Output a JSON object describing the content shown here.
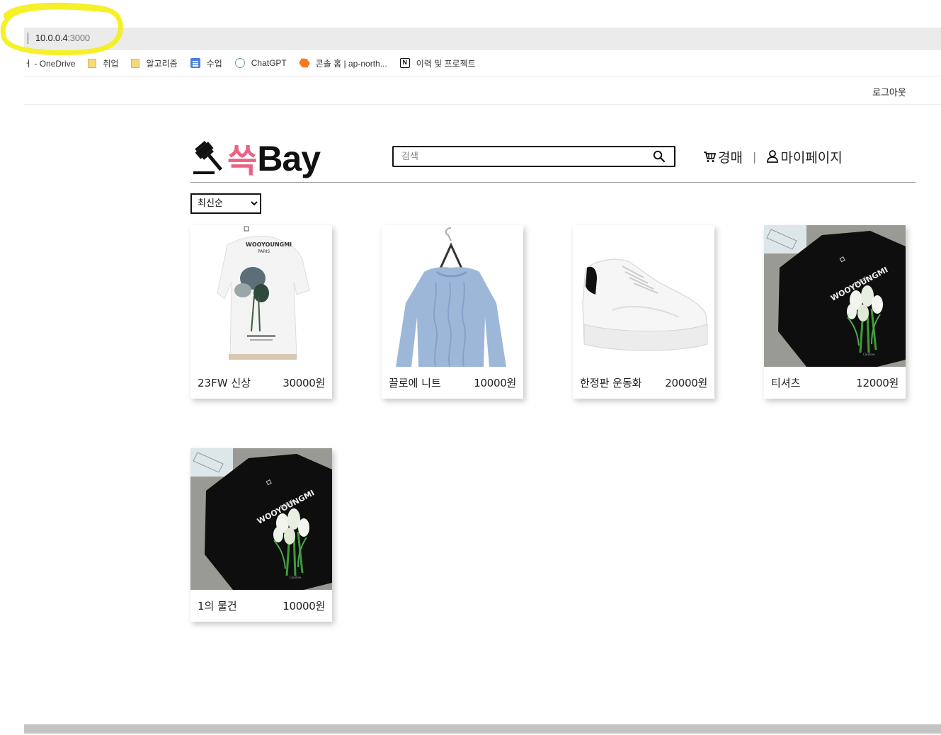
{
  "browser": {
    "url_host": "10.0.0.4",
    "url_port": ":3000",
    "bookmarks": [
      {
        "label": "ㅓ - OneDrive",
        "icon": "none"
      },
      {
        "label": "취업",
        "icon": "folder-icon"
      },
      {
        "label": "알고리즘",
        "icon": "folder-icon"
      },
      {
        "label": "수업",
        "icon": "document-icon"
      },
      {
        "label": "ChatGPT",
        "icon": "chatgpt-icon"
      },
      {
        "label": "콘솔 홈 | ap-north...",
        "icon": "aws-icon"
      },
      {
        "label": "이력 및 프로젝트",
        "icon": "notion-icon"
      }
    ]
  },
  "topbar": {
    "logout_label": "로그아웃"
  },
  "header": {
    "logo_kr": "쓱",
    "logo_en": "Bay",
    "search_placeholder": "검색",
    "nav_auction": "경매",
    "nav_separator": "|",
    "nav_mypage": "마이페이지"
  },
  "sort": {
    "selected": "최신순"
  },
  "products": [
    {
      "name": "23FW 신상",
      "price": "30000원",
      "image": "white-tshirt-back"
    },
    {
      "name": "끌로에 니트",
      "price": "10000원",
      "image": "blue-knit-sweater"
    },
    {
      "name": "한정판 운동화",
      "price": "20000원",
      "image": "white-platform-sneaker"
    },
    {
      "name": "티셔츠",
      "price": "12000원",
      "image": "black-tshirt-flower"
    },
    {
      "name": "1의 물건",
      "price": "10000원",
      "image": "black-tshirt-flower"
    }
  ],
  "colors": {
    "brand_pink": "#ec6184",
    "highlight": "#f7f000"
  }
}
